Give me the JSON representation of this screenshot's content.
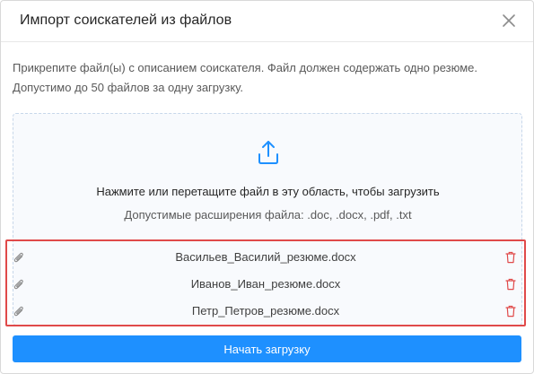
{
  "modal": {
    "title": "Импорт соискателей из файлов",
    "close_icon": "close-icon"
  },
  "description": {
    "line1": "Прикрепите файл(ы) с описанием соискателя. Файл должен содержать одно резюме.",
    "line2": "Допустимо до 50 файлов за одну загрузку."
  },
  "dropzone": {
    "icon": "upload-icon",
    "main_text": "Нажмите или перетащите файл в эту область, чтобы загрузить",
    "sub_text": "Допустимые расширения файла: .doc, .docx, .pdf, .txt"
  },
  "files": [
    {
      "name": "Васильев_Василий_резюме.docx",
      "icon": "paperclip-icon",
      "action_icon": "trash-icon"
    },
    {
      "name": "Иванов_Иван_резюме.docx",
      "icon": "paperclip-icon",
      "action_icon": "trash-icon"
    },
    {
      "name": "Петр_Петров_резюме.docx",
      "icon": "paperclip-icon",
      "action_icon": "trash-icon"
    }
  ],
  "actions": {
    "start_label": "Начать загрузку"
  },
  "colors": {
    "accent": "#1e90ff",
    "danger": "#e04a4a",
    "highlight_border": "#e04a4a"
  }
}
